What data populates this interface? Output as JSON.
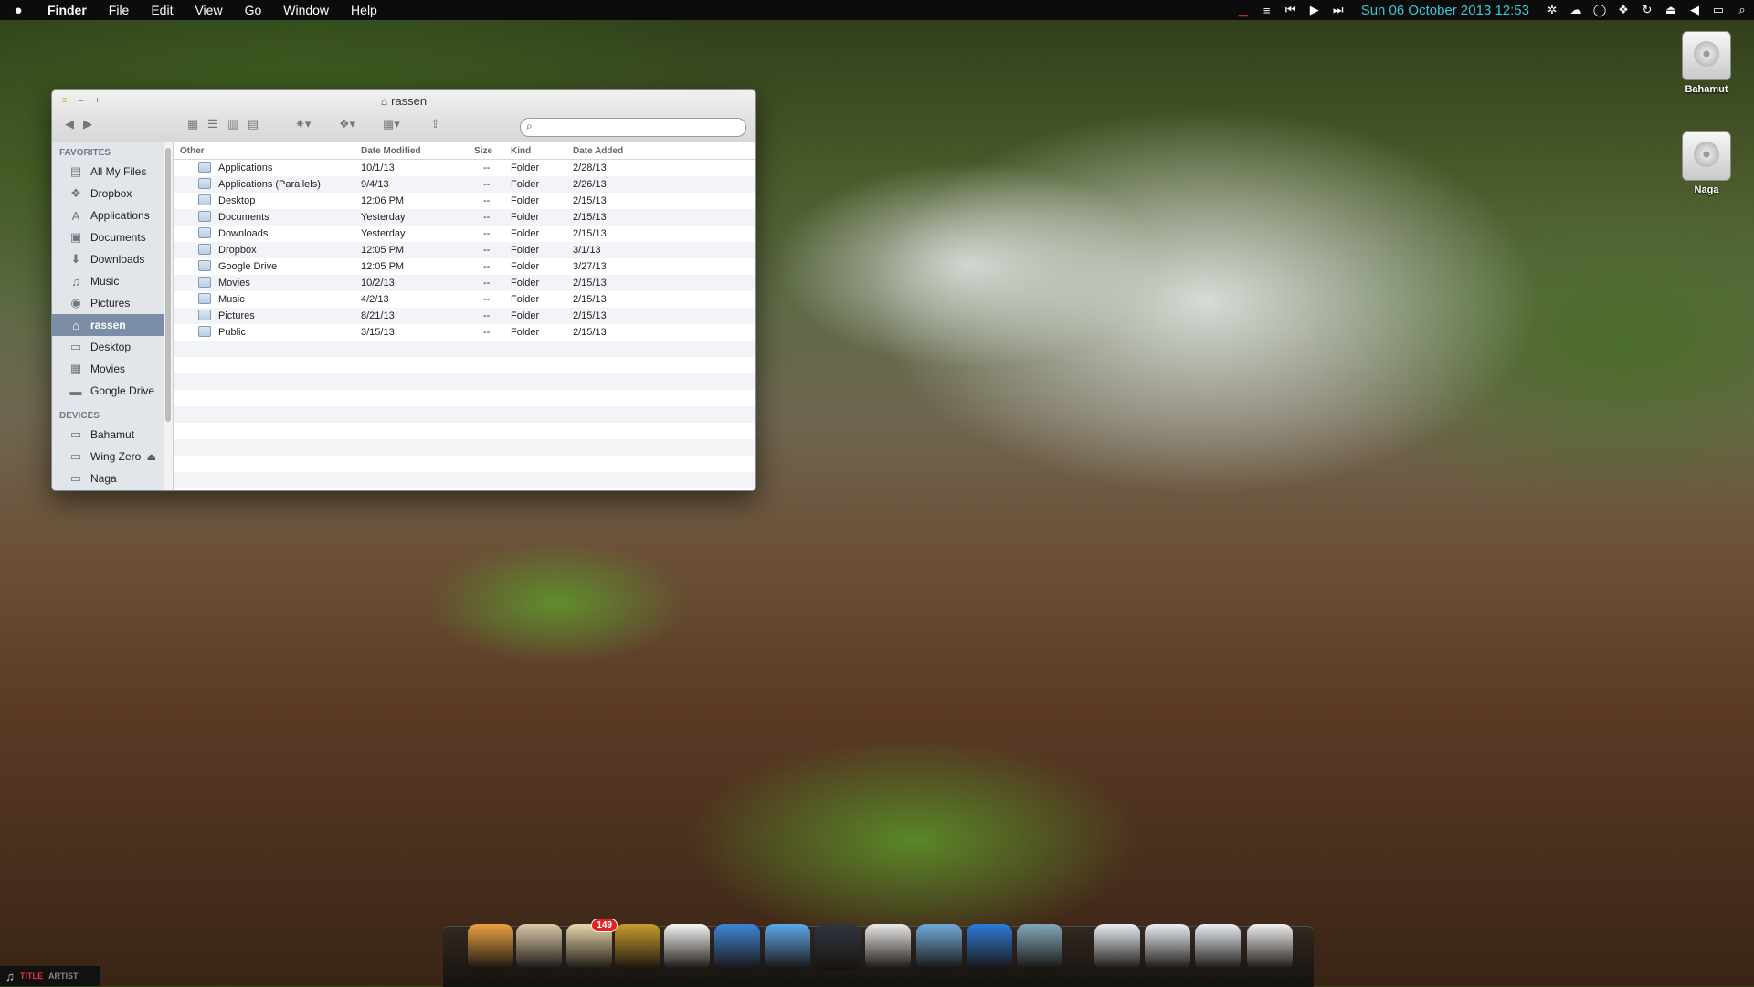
{
  "menubar": {
    "apple_icon": "apple-icon",
    "app_name": "Finder",
    "menus": [
      "File",
      "Edit",
      "View",
      "Go",
      "Window",
      "Help"
    ],
    "clock": "Sun 06 October 2013  12:53",
    "status_icons": [
      "monitor-icon",
      "list-icon",
      "previous-icon",
      "play-icon",
      "next-icon",
      "clock-text",
      "brightness-icon",
      "cloud-icon",
      "chat-icon",
      "dropbox-icon",
      "sync-icon",
      "eject-icon",
      "volume-icon",
      "battery-icon",
      "search-icon"
    ]
  },
  "desktop": {
    "drives": [
      {
        "label": "Bahamut"
      },
      {
        "label": "Naga"
      }
    ]
  },
  "finder": {
    "title": "rassen",
    "search_placeholder": "",
    "sidebar": {
      "favorites_heading": "FAVORITES",
      "favorites": [
        {
          "label": "All My Files",
          "icon": "all-files-icon"
        },
        {
          "label": "Dropbox",
          "icon": "dropbox-icon"
        },
        {
          "label": "Applications",
          "icon": "applications-icon"
        },
        {
          "label": "Documents",
          "icon": "documents-icon"
        },
        {
          "label": "Downloads",
          "icon": "downloads-icon"
        },
        {
          "label": "Music",
          "icon": "music-icon"
        },
        {
          "label": "Pictures",
          "icon": "pictures-icon"
        },
        {
          "label": "rassen",
          "icon": "home-icon",
          "selected": true
        },
        {
          "label": "Desktop",
          "icon": "desktop-icon"
        },
        {
          "label": "Movies",
          "icon": "movies-icon"
        },
        {
          "label": "Google Drive",
          "icon": "folder-icon"
        }
      ],
      "devices_heading": "DEVICES",
      "devices": [
        {
          "label": "Bahamut",
          "icon": "disk-icon"
        },
        {
          "label": "Wing Zero",
          "icon": "disk-icon",
          "eject": "⏏"
        },
        {
          "label": "Naga",
          "icon": "disk-icon"
        }
      ]
    },
    "columns": {
      "name": "Other",
      "modified": "Date Modified",
      "size": "Size",
      "kind": "Kind",
      "added": "Date Added"
    },
    "rows": [
      {
        "name": "Applications",
        "modified": "10/1/13",
        "size": "--",
        "kind": "Folder",
        "added": "2/28/13"
      },
      {
        "name": "Applications (Parallels)",
        "modified": "9/4/13",
        "size": "--",
        "kind": "Folder",
        "added": "2/26/13"
      },
      {
        "name": "Desktop",
        "modified": "12:06 PM",
        "size": "--",
        "kind": "Folder",
        "added": "2/15/13"
      },
      {
        "name": "Documents",
        "modified": "Yesterday",
        "size": "--",
        "kind": "Folder",
        "added": "2/15/13"
      },
      {
        "name": "Downloads",
        "modified": "Yesterday",
        "size": "--",
        "kind": "Folder",
        "added": "2/15/13"
      },
      {
        "name": "Dropbox",
        "modified": "12:05 PM",
        "size": "--",
        "kind": "Folder",
        "added": "3/1/13"
      },
      {
        "name": "Google Drive",
        "modified": "12:05 PM",
        "size": "--",
        "kind": "Folder",
        "added": "3/27/13"
      },
      {
        "name": "Movies",
        "modified": "10/2/13",
        "size": "--",
        "kind": "Folder",
        "added": "2/15/13"
      },
      {
        "name": "Music",
        "modified": "4/2/13",
        "size": "--",
        "kind": "Folder",
        "added": "2/15/13"
      },
      {
        "name": "Pictures",
        "modified": "8/21/13",
        "size": "--",
        "kind": "Folder",
        "added": "2/15/13"
      },
      {
        "name": "Public",
        "modified": "3/15/13",
        "size": "--",
        "kind": "Folder",
        "added": "2/15/13"
      }
    ]
  },
  "dock": {
    "items": [
      {
        "name": "finder-app-icon",
        "color": "#e8a040"
      },
      {
        "name": "owl-app-icon",
        "color": "#d8c9a8"
      },
      {
        "name": "notes-app-icon",
        "color": "#e6d6a8",
        "badge": "149"
      },
      {
        "name": "itunes-app-icon",
        "color": "#c89b2a"
      },
      {
        "name": "cnn-app-icon",
        "color": "#f4f4f4"
      },
      {
        "name": "safari-app-icon",
        "color": "#3a86d8"
      },
      {
        "name": "messages-app-icon",
        "color": "#5aa8e8"
      },
      {
        "name": "camera-app-icon",
        "color": "#2e3440"
      },
      {
        "name": "twitter-app-icon",
        "color": "#e8e8e8"
      },
      {
        "name": "preview-app-icon",
        "color": "#6fa8d8"
      },
      {
        "name": "word-app-icon",
        "color": "#2b7ad9"
      },
      {
        "name": "remote-desktop-app-icon",
        "color": "#7fa6b8"
      },
      {
        "name": "documents-stack-icon",
        "color": "#e8eef4"
      },
      {
        "name": "applications-stack-icon",
        "color": "#e8eef4"
      },
      {
        "name": "downloads-stack-icon",
        "color": "#e8eef4"
      },
      {
        "name": "trash-icon",
        "color": "#eeeeee"
      }
    ]
  },
  "nowplaying": {
    "title": "TITLE",
    "artist": "ARTIST"
  }
}
